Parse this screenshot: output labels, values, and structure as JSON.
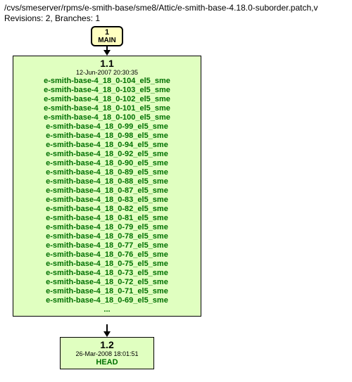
{
  "header": {
    "path": "/cvs/smeserver/rpms/e-smith-base/sme8/Attic/e-smith-base-4.18.0-suborder.patch,v",
    "stats": "Revisions: 2, Branches: 1"
  },
  "branch": {
    "num": "1",
    "name": "MAIN"
  },
  "rev11": {
    "num": "1.1",
    "date": "12-Jun-2007 20:30:35",
    "tags": [
      "e-smith-base-4_18_0-104_el5_sme",
      "e-smith-base-4_18_0-103_el5_sme",
      "e-smith-base-4_18_0-102_el5_sme",
      "e-smith-base-4_18_0-101_el5_sme",
      "e-smith-base-4_18_0-100_el5_sme",
      "e-smith-base-4_18_0-99_el5_sme",
      "e-smith-base-4_18_0-98_el5_sme",
      "e-smith-base-4_18_0-94_el5_sme",
      "e-smith-base-4_18_0-92_el5_sme",
      "e-smith-base-4_18_0-90_el5_sme",
      "e-smith-base-4_18_0-89_el5_sme",
      "e-smith-base-4_18_0-88_el5_sme",
      "e-smith-base-4_18_0-87_el5_sme",
      "e-smith-base-4_18_0-83_el5_sme",
      "e-smith-base-4_18_0-82_el5_sme",
      "e-smith-base-4_18_0-81_el5_sme",
      "e-smith-base-4_18_0-79_el5_sme",
      "e-smith-base-4_18_0-78_el5_sme",
      "e-smith-base-4_18_0-77_el5_sme",
      "e-smith-base-4_18_0-76_el5_sme",
      "e-smith-base-4_18_0-75_el5_sme",
      "e-smith-base-4_18_0-73_el5_sme",
      "e-smith-base-4_18_0-72_el5_sme",
      "e-smith-base-4_18_0-71_el5_sme",
      "e-smith-base-4_18_0-69_el5_sme"
    ],
    "ellipsis": "..."
  },
  "rev12": {
    "num": "1.2",
    "date": "26-Mar-2008 18:01:51",
    "tag": "HEAD"
  }
}
